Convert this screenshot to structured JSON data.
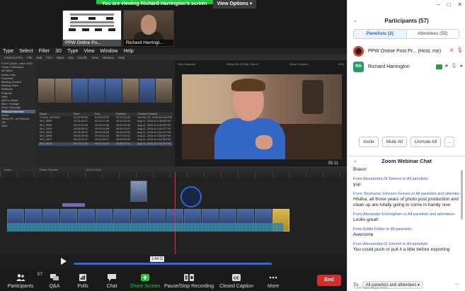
{
  "banner": {
    "message": "You are viewing Richard Harrington's screen",
    "view_options": "View Options"
  },
  "thumbnails": {
    "ppw": {
      "name": "PPW Online Po..."
    },
    "rh": {
      "name": "Richard Harringt..."
    }
  },
  "mac_menu": [
    "Type",
    "Select",
    "Filter",
    "3D",
    "Type",
    "View",
    "Window",
    "Help"
  ],
  "fcp_menu": [
    "Final Cut Pro",
    "File",
    "Edit",
    "Trim",
    "Mark",
    "Clip",
    "Modify",
    "View",
    "Window",
    "Help"
  ],
  "library": [
    "FCPX Quick...nline 2020",
    "Smart Collections",
    "All Video",
    "Audio Only",
    "Favorites",
    "Missing Unused",
    "Missing Used",
    "Multicam",
    "Projects",
    "Stills",
    "B&G's Media",
    "Misc. Footage",
    "Photo Montage",
    "Prescott Interview",
    "Music",
    "Olivia PK...ia Prescott",
    "Sfx",
    "SotX"
  ],
  "library_selected": 13,
  "clip_table": {
    "headers": [
      "Name",
      "Start",
      "End",
      "Duration",
      "Content Created"
    ],
    "rows": [
      [
        "Z Ours_0GFDX0",
        "01:00:00:00",
        "01:00:10:00",
        "00:00:10:00",
        "Sat Dec 31, 2016 at 6:08 PM"
      ],
      [
        "MVI_3989",
        "00:14:48:07",
        "00:16:17:00",
        "00:01:28:18",
        "Aug 11, 2016 at 2:38:46 PM"
      ],
      [
        "MVI_3990",
        "00:07:09:18",
        "00:09:19:00",
        "00:02:09:06",
        "Aug 11, 2016 at 2:40:45 PM"
      ],
      [
        "MVI_3994",
        "00:08:55:01",
        "00:09:44:08",
        "00:00:49:07",
        "Aug 11, 2016 at 2:43:47 PM"
      ],
      [
        "MVI_3995",
        "00:04:35:47",
        "00:08:44:06",
        "00:04:09:03",
        "Aug 11, 2016 at 2:51:23 PM"
      ],
      [
        "MVI_3996",
        "00:08:26:03",
        "00:15:31:14",
        "00:07:05:11",
        "Aug 11, 2016 at 2:56:48 PM"
      ],
      [
        "MVI_3997",
        "00:22:30:47",
        "00:22:30:47",
        "00:00:00:00",
        "Aug 11, 2016 at 3:10:28 PM"
      ],
      [
        "MVI_3978",
        "00:17:07:12",
        "00:17:14:13",
        "00:00:07:01",
        "Aug 11, 2016 at 2:31:33 PM"
      ]
    ],
    "selected": 7
  },
  "viewer": {
    "header_left": "Hide Rejected",
    "header_mid": "1080p HD 23.98p, Stereo",
    "header_right": "Clean Practice",
    "zoom": "62%",
    "timecode": "35:11"
  },
  "timeline": {
    "index": "Index",
    "project": "Clean Practice",
    "duration": "01:11:14:15"
  },
  "transport": {
    "timecode": "1:44:11"
  },
  "zoom_toolbar": {
    "participants": {
      "label": "Participants",
      "count": "57"
    },
    "qa": "Q&A",
    "polls": "Polls",
    "chat": "Chat",
    "share": "Share Screen",
    "pause": "Pause/Stop Recording",
    "cc": "Closed Caption",
    "more": "More",
    "end": "End"
  },
  "participants_panel": {
    "title": "Participants (57)",
    "tabs": [
      "Panelists (2)",
      "Attendees (55)"
    ],
    "people": [
      {
        "initials": "",
        "name": "PPW Online Post Pr... (Host, me)"
      },
      {
        "initials": "RH",
        "name": "Richard Harrington"
      }
    ],
    "actions": {
      "invite": "Invite",
      "mute_all": "Mute All",
      "unmute_all": "Unmute All",
      "more": "..."
    }
  },
  "chat": {
    "title": "Zoom Webinar Chat",
    "messages": [
      {
        "from": "",
        "text": "Bravo!"
      },
      {
        "from": "From Alessandra Di Simone to All panelists:",
        "text": "yup"
      },
      {
        "from": "From Stephanie Johnson-Graves to All panelists and attendees:",
        "text": "Hhaha, all those years of photo post production and clean up are totally going to come in handy now"
      },
      {
        "from": "From Alexander Everingham to All panelists and attendees:",
        "text": "Looks great!"
      },
      {
        "from": "From Eddie Felker to All panelists:",
        "text": "Awesome"
      },
      {
        "from": "From Alessandra Di Simone to All panelists:",
        "text": "You could push or pull it a little before exporting"
      }
    ],
    "to_label": "To:",
    "to_value": "All panelists and attendees",
    "placeholder": "Type message here..."
  },
  "window_controls": {
    "minimize": "–",
    "maximize": "□",
    "close": "✕"
  }
}
